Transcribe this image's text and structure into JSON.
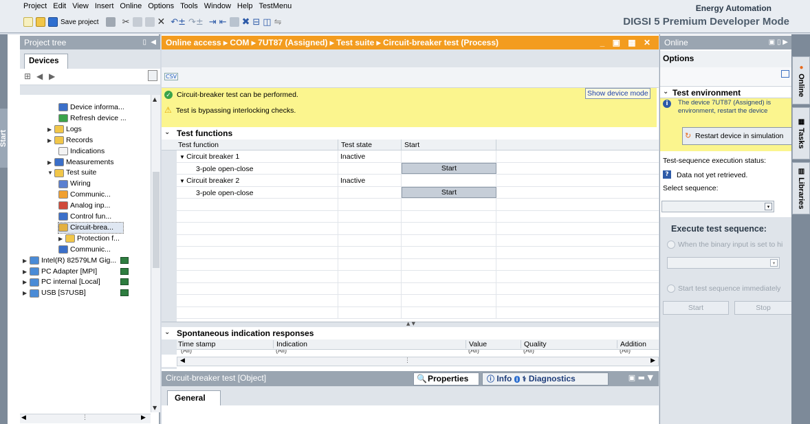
{
  "menu": [
    "Project",
    "Edit",
    "View",
    "Insert",
    "Online",
    "Options",
    "Tools",
    "Window",
    "Help",
    "TestMenu"
  ],
  "toolbar": {
    "save_label": "Save project"
  },
  "brand": {
    "line1": "Energy Automation",
    "line2": "DIGSI 5 Premium Developer Mode"
  },
  "project_tree": {
    "title": "Project tree",
    "tab": "Devices",
    "items": [
      {
        "label": "Device informa...",
        "indent": 3,
        "arrow": ""
      },
      {
        "label": "Refresh device ...",
        "indent": 3,
        "arrow": ""
      },
      {
        "label": "Logs",
        "indent": 2,
        "arrow": "▶"
      },
      {
        "label": "Records",
        "indent": 2,
        "arrow": "▶"
      },
      {
        "label": "Indications",
        "indent": 3,
        "arrow": ""
      },
      {
        "label": "Measurements",
        "indent": 2,
        "arrow": "▶"
      },
      {
        "label": "Test suite",
        "indent": 2,
        "arrow": "▼"
      },
      {
        "label": "Wiring",
        "indent": 3,
        "arrow": ""
      },
      {
        "label": "Communic...",
        "indent": 3,
        "arrow": ""
      },
      {
        "label": "Analog inp...",
        "indent": 3,
        "arrow": ""
      },
      {
        "label": "Control fun...",
        "indent": 3,
        "arrow": ""
      },
      {
        "label": "Circuit-brea...",
        "indent": 3,
        "arrow": ""
      },
      {
        "label": "Protection f...",
        "indent": 3,
        "arrow": "▶"
      },
      {
        "label": "Communic...",
        "indent": 3,
        "arrow": ""
      },
      {
        "label": "Intel(R) 82579LM Gig...",
        "indent": 0,
        "arrow": "▶"
      },
      {
        "label": "PC Adapter [MPI]",
        "indent": 0,
        "arrow": "▶"
      },
      {
        "label": "PC internal [Local]",
        "indent": 0,
        "arrow": "▶"
      },
      {
        "label": "USB [S7USB]",
        "indent": 0,
        "arrow": "▶"
      }
    ],
    "start_tab": "Start"
  },
  "breadcrumb": {
    "text": "Online access ▸ COM ▸ 7UT87 (Assigned) ▸ Test suite ▸ Circuit-breaker test (Process)"
  },
  "csv_label": "CSV",
  "messages": [
    {
      "text": "Circuit-breaker test can be performed.",
      "type": "ok"
    },
    {
      "text": "Test is bypassing interlocking checks.",
      "type": "warn"
    }
  ],
  "show_device_mode": "Show device mode",
  "test_functions": {
    "title": "Test functions",
    "columns": [
      "Test function",
      "Test state",
      "Start"
    ],
    "rows": [
      {
        "name": "Circuit breaker 1",
        "state": "Inactive",
        "button": "",
        "group": true
      },
      {
        "name": "3-pole open-close",
        "state": "",
        "button": "Start",
        "group": false
      },
      {
        "name": "Circuit breaker 2",
        "state": "Inactive",
        "button": "",
        "group": true
      },
      {
        "name": "3-pole open-close",
        "state": "",
        "button": "Start",
        "group": false
      }
    ]
  },
  "spontaneous": {
    "title": "Spontaneous indication responses",
    "columns": [
      "Time stamp",
      "Indication",
      "Value",
      "Quality",
      "Addition"
    ],
    "filter": "(All)"
  },
  "object_bar": {
    "title": "Circuit-breaker test [Object]",
    "tabs": [
      "Properties",
      "Info",
      "Diagnostics"
    ],
    "general_tab": "General"
  },
  "online_panel": {
    "title": "Online",
    "options_label": "Options",
    "section_title": "Test environment",
    "info_text": "The device 7UT87 (Assigned) is environment, restart the device",
    "restart_button": "Restart device in simulation",
    "exec_status_label": "Test-sequence execution status:",
    "status_value": "Data not yet retrieved.",
    "select_sequence_label": "Select sequence:",
    "execute_title": "Execute test sequence:",
    "radio1": "When the binary input is set to hi",
    "radio2": "Start test sequence immediately",
    "start_button": "Start",
    "stop_button": "Stop"
  },
  "side_tabs": [
    "Online",
    "Tasks",
    "Libraries"
  ]
}
